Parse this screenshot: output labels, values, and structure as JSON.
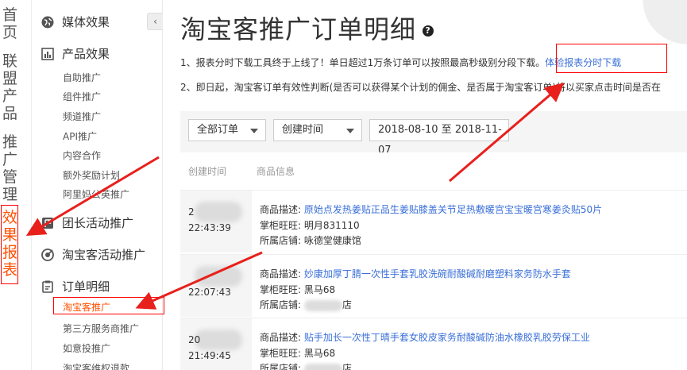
{
  "left_nav": {
    "items": [
      {
        "label": "首页",
        "active": false
      },
      {
        "label": "联盟产品",
        "active": false
      },
      {
        "label": "推广管理",
        "active": false
      },
      {
        "label": "效果报表",
        "active": true
      }
    ]
  },
  "side_nav": {
    "collapse_icon": "chevron-left-icon",
    "sections": [
      {
        "label": "媒体效果",
        "icon": "globe-icon"
      },
      {
        "label": "产品效果",
        "icon": "chart-icon",
        "items": [
          "自助推广",
          "组件推广",
          "频道推广",
          "API推广",
          "内容合作",
          "额外奖励计划",
          "阿里妈公英推广"
        ]
      },
      {
        "label": "团长活动推广",
        "icon": "flag-icon"
      },
      {
        "label": "淘宝客活动推广",
        "icon": "target-icon"
      },
      {
        "label": "订单明细",
        "icon": "clipboard-icon",
        "items": [
          "淘宝客推广",
          "第三方服务商推广",
          "如意投推广",
          "淘宝客维权退款"
        ]
      }
    ],
    "active_item": "淘宝客推广"
  },
  "page": {
    "title": "淘宝客推广订单明细",
    "notice1": "1、报表分时下载工具终于上线了！单日超过1万条订单可以按照最高秒级别分段下载。",
    "notice1_link": "体验报表分时下载",
    "notice2": "2、即日起，淘宝客订单有效性判断(是否可以获得某个计划的佣金、是否属于淘宝客订单)将以买家点击时间是否在"
  },
  "filters": {
    "order_type": "全部订单",
    "time_type": "创建时间",
    "date_range": "2018-08-10 至 2018-11-07"
  },
  "table": {
    "headers": [
      "创建时间",
      "商品信息"
    ],
    "labels": {
      "desc": "商品描述:",
      "wangwang": "掌柜旺旺:",
      "shop": "所属店铺:"
    },
    "rows": [
      {
        "date": "2",
        "time": "22:43:39",
        "desc": "原始点发热姜贴正品生姜贴膝盖关节足热敷暖宫宝宝暖宫寒姜灸贴50片",
        "wangwang": "明月831110",
        "shop": "咏德堂健康馆"
      },
      {
        "date": "",
        "time": "22:07:43",
        "desc": "妙康加厚丁腈一次性手套乳胶洗碗耐酸碱耐磨塑料家务防水手套",
        "wangwang": "黑马68",
        "shop": "店"
      },
      {
        "date": "20",
        "time": "21:49:45",
        "desc": "贴手加长一次性丁晴手套女胶皮家务耐酸碱防油水橡胶乳胶劳保工业",
        "wangwang": "黑马68",
        "shop": "店"
      }
    ]
  },
  "colors": {
    "accent": "#ff5000",
    "link": "#3a6fd8",
    "annotation": "#ff0000"
  }
}
